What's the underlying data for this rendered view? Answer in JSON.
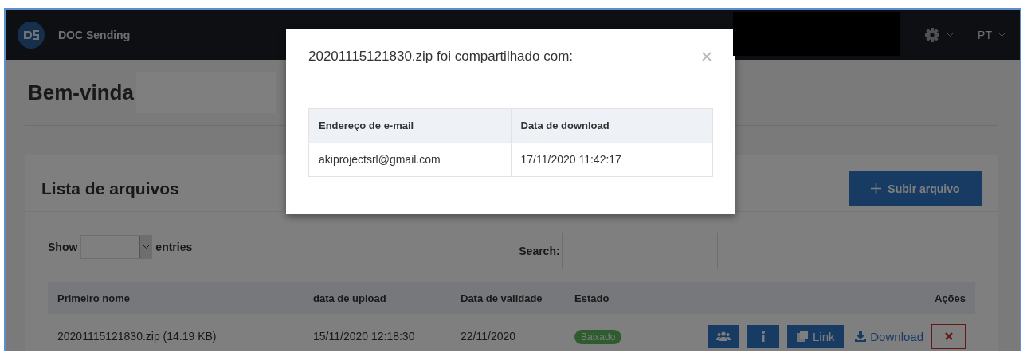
{
  "navbar": {
    "brand": "DOC Sending",
    "language": "PT"
  },
  "welcome": {
    "heading": "Bem-vinda"
  },
  "card": {
    "title": "Lista de arquivos",
    "upload_button": "Subir arquivo"
  },
  "table_controls": {
    "show_label": "Show",
    "entries_label": "entries",
    "search_label": "Search:"
  },
  "table": {
    "columns": [
      "Primeiro nome",
      "data de upload",
      "Data de validade",
      "Estado",
      "Ações"
    ],
    "rows": [
      {
        "name": "20201115121830.zip (14.19 KB)",
        "upload_date": "15/11/2020 12:18:30",
        "expiry_date": "22/11/2020",
        "status": "Baixado",
        "actions": [
          {
            "kind": "share"
          },
          {
            "kind": "info"
          },
          {
            "kind": "link",
            "label": "Link"
          },
          {
            "kind": "download",
            "label": "Download"
          },
          {
            "kind": "delete"
          }
        ]
      }
    ]
  },
  "modal": {
    "title": "20201115121830.zip foi compartilhado com:",
    "columns": [
      "Endereço de e-mail",
      "Data de download"
    ],
    "rows": [
      {
        "email": "akiprojectsrl@gmail.com",
        "date": "17/11/2020 11:42:17"
      }
    ]
  }
}
